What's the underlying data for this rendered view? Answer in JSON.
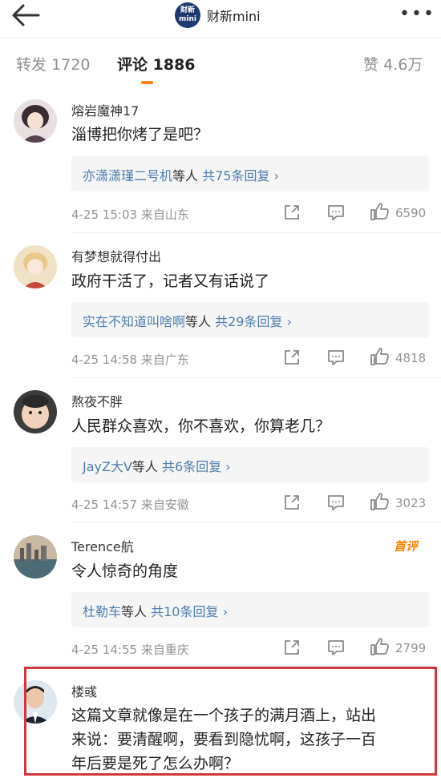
{
  "header": {
    "app_name": "财新mini",
    "logo_text": "财新"
  },
  "tabs": [
    {
      "label": "转发",
      "count": "1720"
    },
    {
      "label": "评论",
      "count": "1886"
    },
    {
      "label": "赞",
      "count": "4.6万"
    }
  ],
  "comments": [
    {
      "user": "熔岩魔神17",
      "text": "淄博把你烤了是吧？",
      "reply_users": "亦潇潇瑾二号机",
      "reply_suffix": "等人",
      "reply_count": "共75条回复",
      "time": "4-25 15:03",
      "location": "来自山东",
      "likes": "6590"
    },
    {
      "user": "有梦想就得付出",
      "text": "政府干活了，记者又有话说了",
      "reply_users": "实在不知道叫啥啊",
      "reply_suffix": "等人",
      "reply_count": "共29条回复",
      "time": "4-25 14:58",
      "location": "来自广东",
      "likes": "4818"
    },
    {
      "user": "熬夜不胖",
      "text": "人民群众喜欢，你不喜欢，你算老几？",
      "reply_users": "JayZ大V",
      "reply_suffix": "等人",
      "reply_count": "共6条回复",
      "time": "4-25 14:57",
      "location": "来自安徽",
      "likes": "3023"
    },
    {
      "user": "Terence航",
      "badge": "首评",
      "text": "令人惊奇的角度",
      "reply_users": "杜勒车",
      "reply_suffix": "等人",
      "reply_count": "共10条回复",
      "time": "4-25 14:55",
      "location": "来自重庆",
      "likes": "2799"
    },
    {
      "user": "楼彧",
      "lines": [
        "这篇文章就像是在一个孩子的满月酒上，站出",
        "来说：要清醒啊，要看到隐忧啊，这孩子一百",
        "年后要是死了怎么办啊？"
      ]
    }
  ],
  "colors": {
    "accent": "#ff8200",
    "link": "#507daf",
    "highlight": "#d4343e"
  }
}
